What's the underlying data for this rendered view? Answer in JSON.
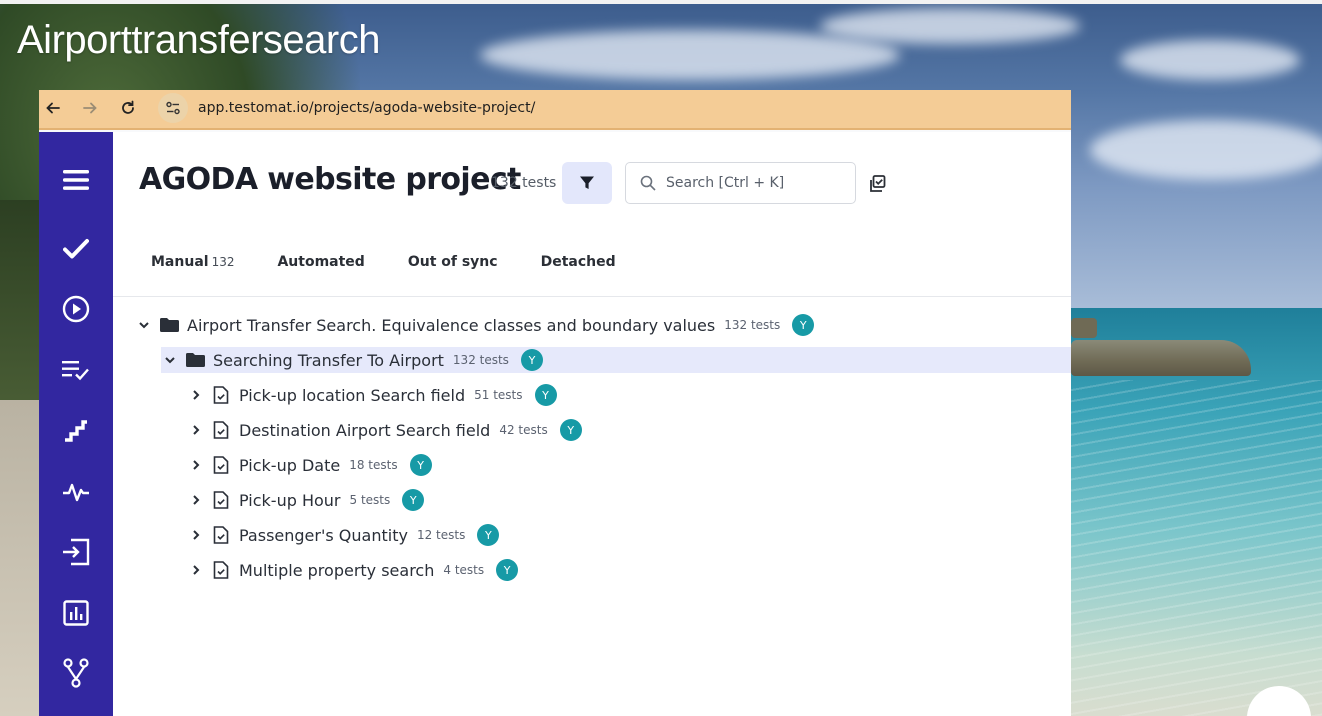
{
  "slide": {
    "title": "Airporttransfersearch"
  },
  "browser": {
    "url": "app.testomat.io/projects/agoda-website-project/",
    "back_icon": "arrow-left-icon",
    "forward_icon": "arrow-right-icon",
    "reload_icon": "reload-icon",
    "site_info_icon": "site-settings-icon"
  },
  "sidebar": {
    "items": [
      {
        "icon": "menu-icon"
      },
      {
        "icon": "check-icon"
      },
      {
        "icon": "play-circle-icon"
      },
      {
        "icon": "checklist-icon"
      },
      {
        "icon": "steps-icon"
      },
      {
        "icon": "pulse-icon"
      },
      {
        "icon": "import-icon"
      },
      {
        "icon": "analytics-icon"
      },
      {
        "icon": "branch-icon"
      }
    ]
  },
  "header": {
    "title": "AGODA website project",
    "test_count": "132 tests",
    "search_placeholder": "Search [Ctrl + K]"
  },
  "tabs": [
    {
      "label": "Manual",
      "count": "132"
    },
    {
      "label": "Automated"
    },
    {
      "label": "Out of sync"
    },
    {
      "label": "Detached"
    }
  ],
  "tree": [
    {
      "name": "Airport Transfer Search. Equivalence classes and boundary values",
      "count": "132 tests",
      "avatar": "Y",
      "type": "folder",
      "expanded": true
    },
    {
      "name": "Searching Transfer To Airport",
      "count": "132 tests",
      "avatar": "Y",
      "type": "folder",
      "expanded": true
    },
    {
      "name": "Pick-up location Search field",
      "count": "51 tests",
      "avatar": "Y",
      "type": "file"
    },
    {
      "name": "Destination Airport Search field",
      "count": "42 tests",
      "avatar": "Y",
      "type": "file"
    },
    {
      "name": "Pick-up Date",
      "count": "18 tests",
      "avatar": "Y",
      "type": "file"
    },
    {
      "name": "Pick-up Hour",
      "count": "5 tests",
      "avatar": "Y",
      "type": "file"
    },
    {
      "name": "Passenger's Quantity",
      "count": "12 tests",
      "avatar": "Y",
      "type": "file"
    },
    {
      "name": "Multiple property search",
      "count": "4 tests",
      "avatar": "Y",
      "type": "file"
    }
  ],
  "colors": {
    "sidebar": "#3227a0",
    "address_bar": "#f4cc96",
    "avatar": "#179aa6",
    "selected_row": "#e6e9fb"
  }
}
